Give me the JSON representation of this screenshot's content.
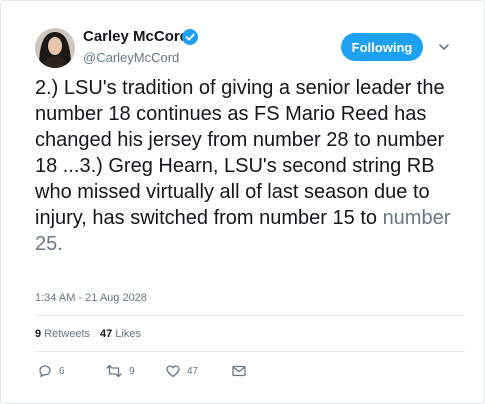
{
  "user": {
    "display_name": "Carley McCord",
    "handle": "@CarleyMcCord",
    "verified_icon": "verified-badge-icon",
    "avatar_icon": "profile-photo"
  },
  "follow_button": {
    "label": "Following"
  },
  "menu": {
    "icon": "chevron-down-icon"
  },
  "tweet": {
    "text_main": "2.) LSU's tradition of giving a senior leader the number 18 continues as FS Mario Reed has changed his jersey from number 28 to number 18 ...3.) Greg Hearn, LSU's second string RB who missed virtually all of last season due to injury, has switched from number 15 to ",
    "text_link": "number 25.",
    "timestamp": "1:34 AM - 21 Aug 2028"
  },
  "stats": {
    "retweets_count": "9",
    "retweets_label": "Retweets",
    "likes_count": "47",
    "likes_label": "Likes"
  },
  "actions": {
    "reply_count": "6",
    "retweet_count": "9",
    "like_count": "47"
  },
  "colors": {
    "accent": "#1da1f2",
    "text": "#14171a",
    "muted": "#657786",
    "divider": "#e6ecf0"
  }
}
